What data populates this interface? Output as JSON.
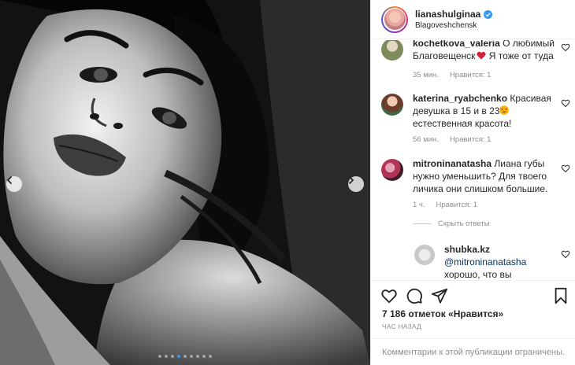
{
  "post": {
    "username": "lianashulginaa",
    "location": "Blagoveshchensk",
    "verified": true,
    "carousel": {
      "slides": 9,
      "active_index": 3
    }
  },
  "comments": [
    {
      "username": "kochetkova_valeria",
      "text": "О любимый Благовещенск",
      "emoji": "red-heart",
      "text_after": " Я тоже от туда",
      "time": "35 мин.",
      "likes": "Нравится: 1"
    },
    {
      "username": "katerina_ryabchenko",
      "text": "Красивая девушка в 15 и в 23",
      "emoji": "heart-eyes",
      "text_after": " естественная красота!",
      "time": "56 мин.",
      "likes": "Нравится: 1"
    },
    {
      "username": "mitroninanatasha",
      "text": "Лиана губы нужно уменьшить? Для твоего личика они слишком большие.",
      "time": "1 ч.",
      "likes": "Нравится: 1"
    }
  ],
  "hide_replies": "Скрыть ответы",
  "reply": {
    "username": "shubka.kz",
    "mention": "@mitroninanatasha",
    "text": "хорошо, что вы"
  },
  "likes_count": "7 186 отметок «Нравится»",
  "timestamp": "ЧАС НАЗАД",
  "comments_disabled": "Комментарии к этой публикации ограничены.",
  "colors": {
    "accent": "#3897f0",
    "verified": "#3897f0",
    "text": "#262626",
    "meta": "#8e8e8e"
  }
}
